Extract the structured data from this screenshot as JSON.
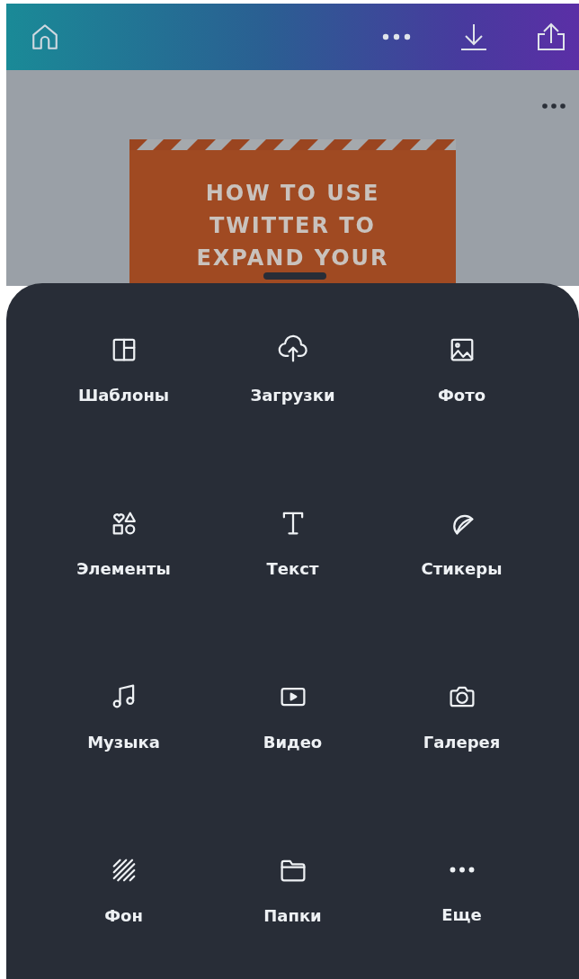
{
  "design": {
    "lines": [
      "HOW TO USE",
      "TWITTER TO",
      "EXPAND YOUR"
    ]
  },
  "panel": {
    "items": [
      {
        "kind": "templates",
        "label": "Шаблоны"
      },
      {
        "kind": "uploads",
        "label": "Загрузки"
      },
      {
        "kind": "photos",
        "label": "Фото"
      },
      {
        "kind": "elements",
        "label": "Элементы"
      },
      {
        "kind": "text",
        "label": "Текст"
      },
      {
        "kind": "stickers",
        "label": "Стикеры"
      },
      {
        "kind": "music",
        "label": "Музыка"
      },
      {
        "kind": "video",
        "label": "Видео"
      },
      {
        "kind": "gallery",
        "label": "Галерея"
      },
      {
        "kind": "background",
        "label": "Фон"
      },
      {
        "kind": "folders",
        "label": "Папки"
      },
      {
        "kind": "more",
        "label": "Еще"
      }
    ]
  }
}
